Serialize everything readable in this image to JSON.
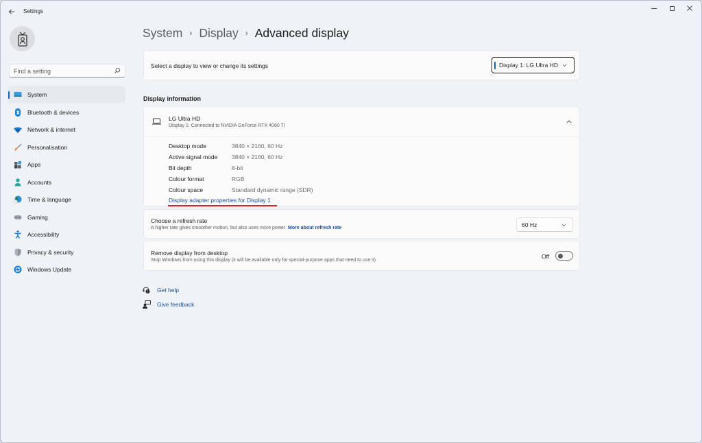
{
  "window": {
    "title": "Settings",
    "controls": {
      "minimize": "minimize",
      "maximize": "maximize",
      "close": "close"
    }
  },
  "sidebar": {
    "search_placeholder": "Find a setting",
    "items": [
      {
        "label": "System",
        "icon": "monitor-icon",
        "active": true
      },
      {
        "label": "Bluetooth & devices",
        "icon": "bluetooth-icon",
        "active": false
      },
      {
        "label": "Network & internet",
        "icon": "wifi-icon",
        "active": false
      },
      {
        "label": "Personalisation",
        "icon": "paintbrush-icon",
        "active": false
      },
      {
        "label": "Apps",
        "icon": "apps-icon",
        "active": false
      },
      {
        "label": "Accounts",
        "icon": "person-icon",
        "active": false
      },
      {
        "label": "Time & language",
        "icon": "globe-clock-icon",
        "active": false
      },
      {
        "label": "Gaming",
        "icon": "gamepad-icon",
        "active": false
      },
      {
        "label": "Accessibility",
        "icon": "accessibility-icon",
        "active": false
      },
      {
        "label": "Privacy & security",
        "icon": "shield-icon",
        "active": false
      },
      {
        "label": "Windows Update",
        "icon": "update-icon",
        "active": false
      }
    ]
  },
  "breadcrumb": {
    "items": [
      "System",
      "Display",
      "Advanced display"
    ],
    "separator": "›"
  },
  "display_select": {
    "label": "Select a display to view or change its settings",
    "value": "Display 1: LG Ultra HD"
  },
  "display_info": {
    "section_title": "Display information",
    "monitor_name": "LG Ultra HD",
    "monitor_sub": "Display 1: Connected to NVIDIA GeForce RTX 4060 Ti",
    "rows": [
      {
        "key": "Desktop mode",
        "value": "3840 × 2160, 60 Hz"
      },
      {
        "key": "Active signal mode",
        "value": "3840 × 2160, 60 Hz"
      },
      {
        "key": "Bit depth",
        "value": "8-bit"
      },
      {
        "key": "Colour format",
        "value": "RGB"
      },
      {
        "key": "Colour space",
        "value": "Standard dynamic range (SDR)"
      }
    ],
    "adapter_link": "Display adapter properties for Display 1",
    "annotation_color": "#e02020"
  },
  "refresh_rate": {
    "title": "Choose a refresh rate",
    "description": "A higher rate gives smoother motion, but also uses more power",
    "link": "More about refresh rate",
    "value": "60 Hz"
  },
  "remove_display": {
    "title": "Remove display from desktop",
    "description": "Stop Windows from using this display (it will be available only for special-purpose apps that need to use it)",
    "toggle_label": "Off",
    "toggle_on": false
  },
  "help": {
    "get_help": "Get help",
    "give_feedback": "Give feedback"
  },
  "colors": {
    "accent": "#0067c0",
    "link": "#1a4f96",
    "background": "#eff3f8",
    "card": "#fbfbfc"
  }
}
